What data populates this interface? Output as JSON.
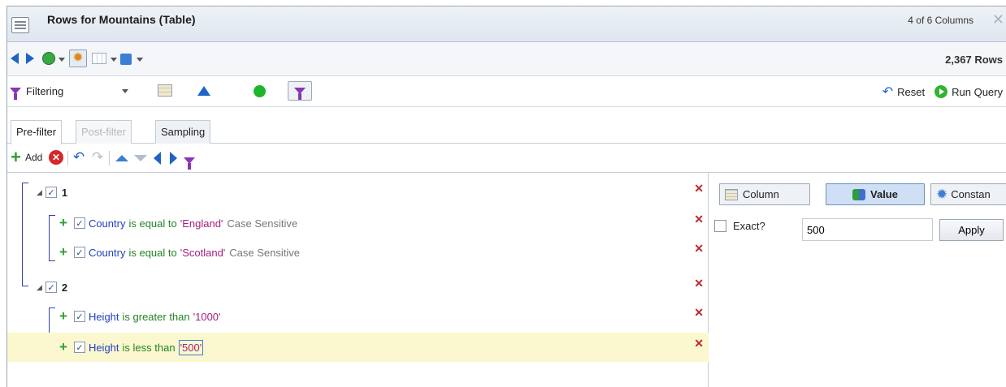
{
  "window": {
    "title": "Rows for Mountains (Table)",
    "column_count": "4 of 6 Columns",
    "row_count": "2,367 Rows"
  },
  "toolbar": {
    "filter_mode": "Filtering",
    "reset_label": "Reset",
    "run_query_label": "Run Query"
  },
  "tabs": [
    {
      "label": "Pre-filter",
      "state": "active"
    },
    {
      "label": "Post-filter",
      "state": "disabled"
    },
    {
      "label": "Sampling",
      "state": "normal"
    }
  ],
  "edit_toolbar": {
    "add_label": "Add"
  },
  "filter_tree": {
    "groups": [
      {
        "label": "1",
        "checked": true,
        "conditions": [
          {
            "column": "Country",
            "operator": "is equal to",
            "value": "'England'",
            "modifier": "Case Sensitive",
            "checked": true
          },
          {
            "column": "Country",
            "operator": "is equal to",
            "value": "'Scotland'",
            "modifier": "Case Sensitive",
            "checked": true
          }
        ]
      },
      {
        "label": "2",
        "checked": true,
        "conditions": [
          {
            "column": "Height",
            "operator": "is greater than",
            "value": "'1000'",
            "modifier": "",
            "checked": true
          },
          {
            "column": "Height",
            "operator": "is less than",
            "value": "'500'",
            "modifier": "",
            "checked": true,
            "selected": true
          }
        ]
      }
    ]
  },
  "value_panel": {
    "column_btn": "Column",
    "value_btn": "Value",
    "constant_btn": "Constan",
    "exact_label": "Exact?",
    "value": "500",
    "apply_label": "Apply"
  },
  "colors": {
    "column_text": "#2041c2",
    "operator_text": "#248424",
    "value_text": "#a4207e",
    "selected_row": "#fbf8cf"
  }
}
